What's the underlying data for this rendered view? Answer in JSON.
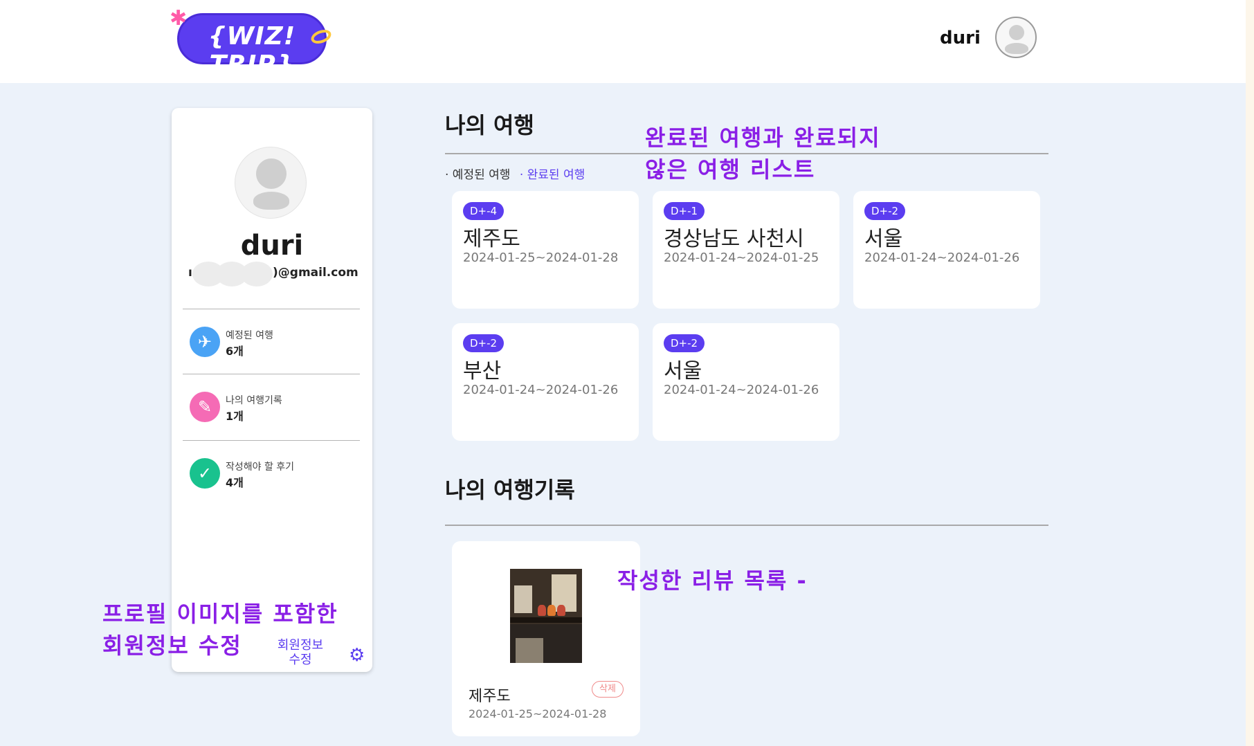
{
  "header": {
    "logo_text": "{WIZ! TRIP}",
    "username": "duri"
  },
  "profile": {
    "name": "duri",
    "email_partial_left": "ı",
    "email_partial_right": ")@gmail.com",
    "stats": [
      {
        "icon": "airplane-icon",
        "label": "예정된 여행",
        "count": "6개",
        "color": "#4aa3f5"
      },
      {
        "icon": "pen-icon",
        "label": "나의 여행기록",
        "count": "1개",
        "color": "#f56bb5"
      },
      {
        "icon": "check-icon",
        "label": "작성해야 할 후기",
        "count": "4개",
        "color": "#19c28e"
      }
    ],
    "edit_label": "회원정보 수정"
  },
  "my_trips": {
    "title": "나의 여행",
    "filters": [
      "· 예정된 여행",
      "· 완료된 여행"
    ],
    "active_filter": 1,
    "trips": [
      {
        "dday": "D+-4",
        "name": "제주도",
        "dates": "2024-01-25~2024-01-28"
      },
      {
        "dday": "D+-1",
        "name": "경상남도 사천시",
        "dates": "2024-01-24~2024-01-25"
      },
      {
        "dday": "D+-2",
        "name": "서울",
        "dates": "2024-01-24~2024-01-26"
      },
      {
        "dday": "D+-2",
        "name": "부산",
        "dates": "2024-01-24~2024-01-26"
      },
      {
        "dday": "D+-2",
        "name": "서울",
        "dates": "2024-01-24~2024-01-26"
      }
    ]
  },
  "my_records": {
    "title": "나의 여행기록",
    "reviews": [
      {
        "place": "제주도",
        "dates": "2024-01-25~2024-01-28",
        "delete_label": "삭제"
      }
    ]
  },
  "annotations": {
    "trips_line1": "완료된 여행과 완료되지",
    "trips_line2": "않은 여행 리스트",
    "reviews": "작성한 리뷰 목록 -",
    "profile_line1": "프로필 이미지를 포함한",
    "profile_line2": "회원정보 수정"
  },
  "colors": {
    "accent": "#5b3df0",
    "annotation": "#8a1fe6",
    "background": "#ecf2fa"
  }
}
